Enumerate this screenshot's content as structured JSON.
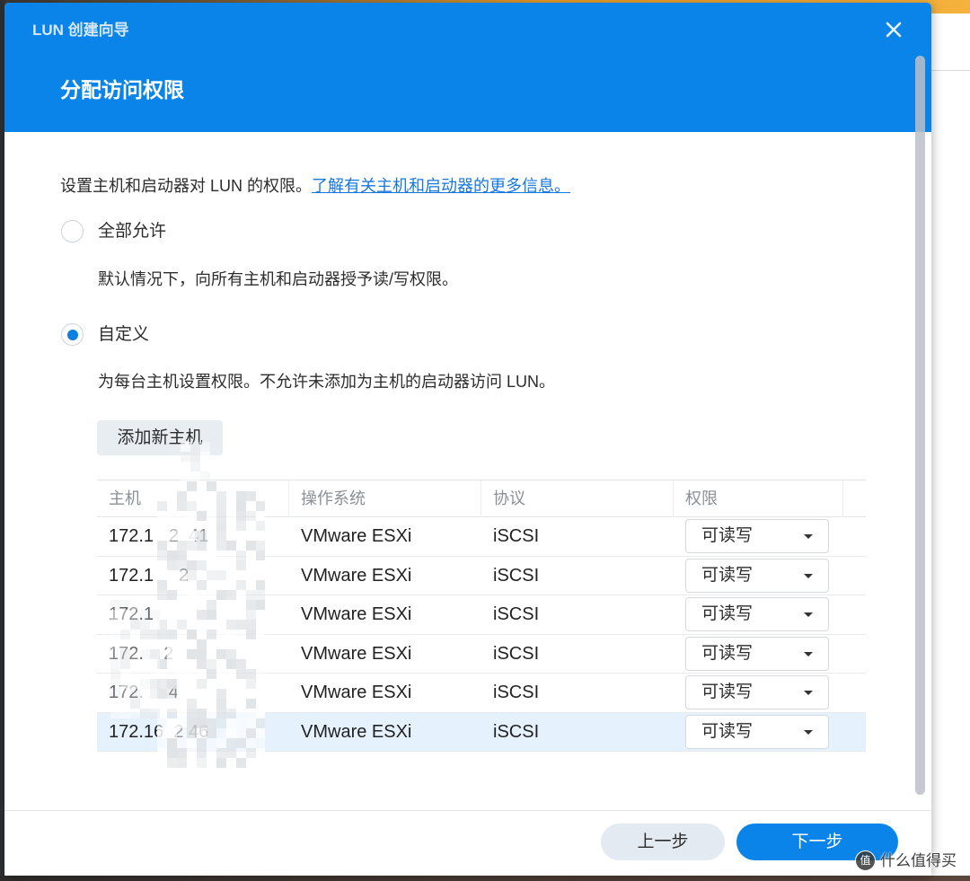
{
  "window": {
    "title": "LUN 创建向导"
  },
  "step": {
    "title": "分配访问权限"
  },
  "intro": {
    "text": "设置主机和启动器对 LUN 的权限。",
    "link": "了解有关主机和启动器的更多信息。"
  },
  "options": [
    {
      "label": "全部允许",
      "description": "默认情况下，向所有主机和启动器授予读/写权限。",
      "selected": false
    },
    {
      "label": "自定义",
      "description": "为每台主机设置权限。不允许未添加为主机的启动器访问 LUN。",
      "selected": true
    }
  ],
  "add_host_label": "添加新主机",
  "table": {
    "columns": [
      "主机",
      "操作系统",
      "协议",
      "权限"
    ],
    "rows": [
      {
        "host": "172.1   2  41",
        "os": "VMware ESXi",
        "protocol": "iSCSI",
        "permission": "可读写",
        "selected": false
      },
      {
        "host": "172.1     2",
        "os": "VMware ESXi",
        "protocol": "iSCSI",
        "permission": "可读写",
        "selected": false
      },
      {
        "host": "172.1",
        "os": "VMware ESXi",
        "protocol": "iSCSI",
        "permission": "可读写",
        "selected": false
      },
      {
        "host": "172.    2",
        "os": "VMware ESXi",
        "protocol": "iSCSI",
        "permission": "可读写",
        "selected": false
      },
      {
        "host": "172.     4",
        "os": "VMware ESXi",
        "protocol": "iSCSI",
        "permission": "可读写",
        "selected": false
      },
      {
        "host": "172.16  2 46",
        "os": "VMware ESXi",
        "protocol": "iSCSI",
        "permission": "可读写",
        "selected": true
      }
    ]
  },
  "footer": {
    "back_label": "上一步",
    "next_label": "下一步"
  },
  "watermark": {
    "badge": "值",
    "text": "什么值得买"
  },
  "icons": {
    "close": "close-icon",
    "dropdown": "chevron-down-icon"
  },
  "colors": {
    "accent": "#0a84e8",
    "selected_row_bg": "#e5f1fd",
    "link": "#1678df"
  }
}
